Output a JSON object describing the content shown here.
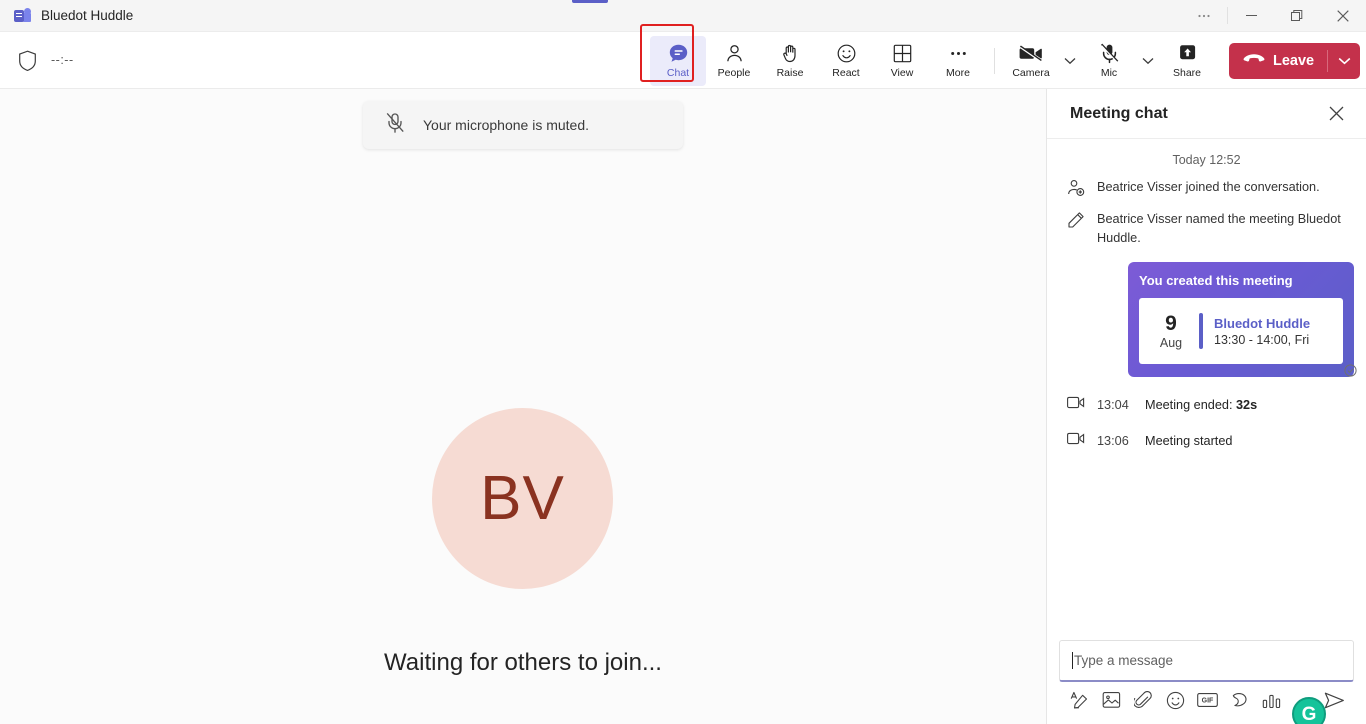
{
  "window": {
    "app_title": "Bluedot Huddle",
    "controls": {
      "more": "more-options",
      "minimize": "minimize",
      "restore": "restore",
      "close": "close"
    }
  },
  "toolbar": {
    "timer": "--:--",
    "shield_icon": "shield-icon",
    "tools": [
      {
        "label": "Chat",
        "icon": "chat-icon",
        "active": true
      },
      {
        "label": "People",
        "icon": "people-icon",
        "active": false
      },
      {
        "label": "Raise",
        "icon": "raise-hand-icon",
        "active": false
      },
      {
        "label": "React",
        "icon": "react-smiley-icon",
        "active": false
      },
      {
        "label": "View",
        "icon": "view-grid-icon",
        "active": false
      },
      {
        "label": "More",
        "icon": "more-ellipsis-icon",
        "active": false
      }
    ],
    "devices": [
      {
        "label": "Camera",
        "icon": "camera-off-icon",
        "has_chevron": true
      },
      {
        "label": "Mic",
        "icon": "mic-off-icon",
        "has_chevron": true
      },
      {
        "label": "Share",
        "icon": "share-screen-icon",
        "has_chevron": false
      }
    ],
    "leave": {
      "label": "Leave",
      "icon": "hangup-icon",
      "chevron_icon": "chevron-down-icon",
      "color": "#c4314b"
    }
  },
  "stage": {
    "toast": {
      "text": "Your microphone is muted.",
      "icon": "mic-off-icon"
    },
    "avatar": {
      "initials": "BV",
      "bg_color": "#f6dbd3",
      "text_color": "#8a3220"
    },
    "waiting_text": "Waiting for others to join..."
  },
  "chat": {
    "title": "Meeting chat",
    "close_icon": "close-icon",
    "daystamp": "Today 12:52",
    "system_messages": [
      {
        "icon": "person-add-icon",
        "text": "Beatrice Visser joined the conversation."
      },
      {
        "icon": "pencil-edit-icon",
        "text": "Beatrice Visser named the meeting Bluedot Huddle."
      }
    ],
    "meeting_card": {
      "header": "You created this meeting",
      "day": "9",
      "month": "Aug",
      "title": "Bluedot Huddle",
      "time": "13:30 - 14:00, Fri",
      "status_icon": "sent-check-icon",
      "accent_color": "#5b5fc7"
    },
    "events": [
      {
        "icon": "video-icon",
        "time": "13:04",
        "text": "Meeting ended: ",
        "bold": "32s"
      },
      {
        "icon": "video-icon",
        "time": "13:06",
        "text": "Meeting started",
        "bold": ""
      }
    ],
    "compose": {
      "placeholder": "Type a message",
      "value": "",
      "tools": [
        {
          "icon": "format-text-icon"
        },
        {
          "icon": "image-icon"
        },
        {
          "icon": "attachment-paperclip-icon"
        },
        {
          "icon": "emoji-icon"
        },
        {
          "icon": "gif-icon"
        },
        {
          "icon": "sticker-icon"
        },
        {
          "icon": "poll-icon"
        }
      ],
      "send_icon": "send-icon",
      "grammarly": {
        "letter": "G",
        "color": "#15c39a"
      }
    }
  }
}
